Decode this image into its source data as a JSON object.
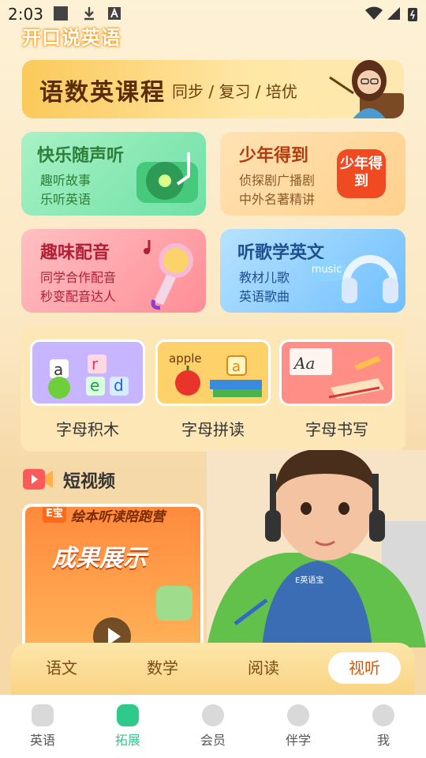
{
  "status": {
    "time": "2:03"
  },
  "header": {
    "logo": "开口说英语"
  },
  "banner": {
    "title": "语数英课程",
    "subtitle": "同步 / 复习 / 培优"
  },
  "cards": [
    {
      "title": "快乐随声听",
      "lines": [
        "趣听故事",
        "乐听英语"
      ],
      "color": "#2f7d3a"
    },
    {
      "title": "少年得到",
      "lines": [
        "侦探剧广播剧",
        "中外名著精讲"
      ],
      "color": "#b23c11",
      "badge": "少年得到"
    },
    {
      "title": "趣味配音",
      "lines": [
        "同学合作配音",
        "秒变配音达人"
      ],
      "color": "#b01f34"
    },
    {
      "title": "听歌学英文",
      "lines": [
        "教材儿歌",
        "英语歌曲"
      ],
      "color": "#1f4f8f",
      "badge": "music"
    }
  ],
  "letters": {
    "items": [
      {
        "label": "字母积木",
        "deco": [
          "a",
          "r",
          "e",
          "d"
        ]
      },
      {
        "label": "字母拼读",
        "deco": [
          "apple",
          "a"
        ]
      },
      {
        "label": "字母书写",
        "deco": [
          "Aa"
        ]
      }
    ]
  },
  "video": {
    "title": "短视频",
    "thumb_tag": "E宝",
    "thumb_line1": "绘本听读陪跑营",
    "thumb_line2": "成果展示",
    "shirt_text": "E英语宝"
  },
  "tabs": [
    {
      "label": "语文",
      "active": false
    },
    {
      "label": "数学",
      "active": false
    },
    {
      "label": "阅读",
      "active": false
    },
    {
      "label": "视听",
      "active": true
    }
  ],
  "nav": [
    {
      "label": "英语",
      "active": false
    },
    {
      "label": "拓展",
      "active": true
    },
    {
      "label": "会员",
      "active": false
    },
    {
      "label": "伴学",
      "active": false
    },
    {
      "label": "我",
      "active": false
    }
  ],
  "colors": {
    "accent": "#d25a0e",
    "nav_active": "#2fc98b"
  }
}
